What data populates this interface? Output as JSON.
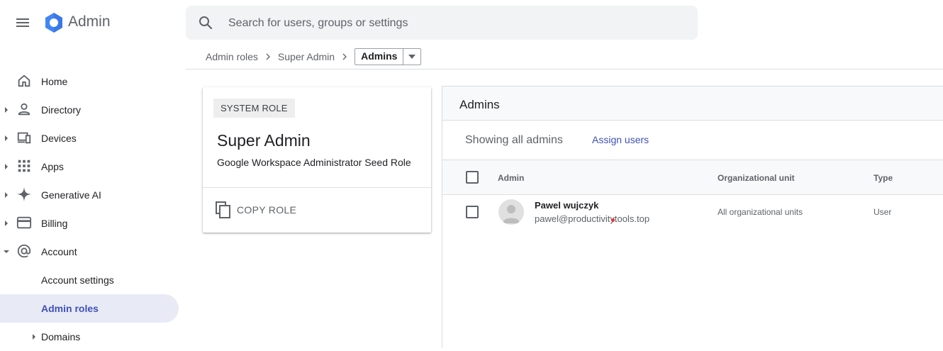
{
  "header": {
    "app_title": "Admin",
    "search_placeholder": "Search for users, groups or settings",
    "icons": [
      "menu-icon",
      "admin-logo",
      "search-icon"
    ]
  },
  "breadcrumb": {
    "items": [
      "Admin roles",
      "Super Admin"
    ],
    "current": "Admins"
  },
  "sidebar": {
    "items": [
      {
        "label": "Home",
        "icon": "home-icon",
        "expandable": false
      },
      {
        "label": "Directory",
        "icon": "person-icon",
        "expandable": true
      },
      {
        "label": "Devices",
        "icon": "devices-icon",
        "expandable": true
      },
      {
        "label": "Apps",
        "icon": "apps-grid-icon",
        "expandable": true
      },
      {
        "label": "Generative AI",
        "icon": "sparkle-icon",
        "expandable": true
      },
      {
        "label": "Billing",
        "icon": "credit-card-icon",
        "expandable": true
      },
      {
        "label": "Account",
        "icon": "at-sign-icon",
        "expanded": true
      }
    ],
    "sub_items": [
      {
        "label": "Account settings",
        "active": false
      },
      {
        "label": "Admin roles",
        "active": true
      },
      {
        "label": "Domains",
        "expandable": true
      }
    ],
    "active_color": "#3f51b5",
    "active_bg": "#e8eaf6"
  },
  "role_card": {
    "chip": "SYSTEM ROLE",
    "title": "Super Admin",
    "description": "Google Workspace Administrator Seed Role",
    "copy_label": "COPY ROLE"
  },
  "admins": {
    "panel_title": "Admins",
    "showing_text": "Showing all admins",
    "assign_label": "Assign users",
    "columns": [
      "Admin",
      "Organizational unit",
      "Type"
    ],
    "rows": [
      {
        "name": "Pawel wujczyk",
        "email": "pawel@productivitytools.top",
        "org_unit": "All organizational units",
        "type": "User"
      }
    ]
  }
}
